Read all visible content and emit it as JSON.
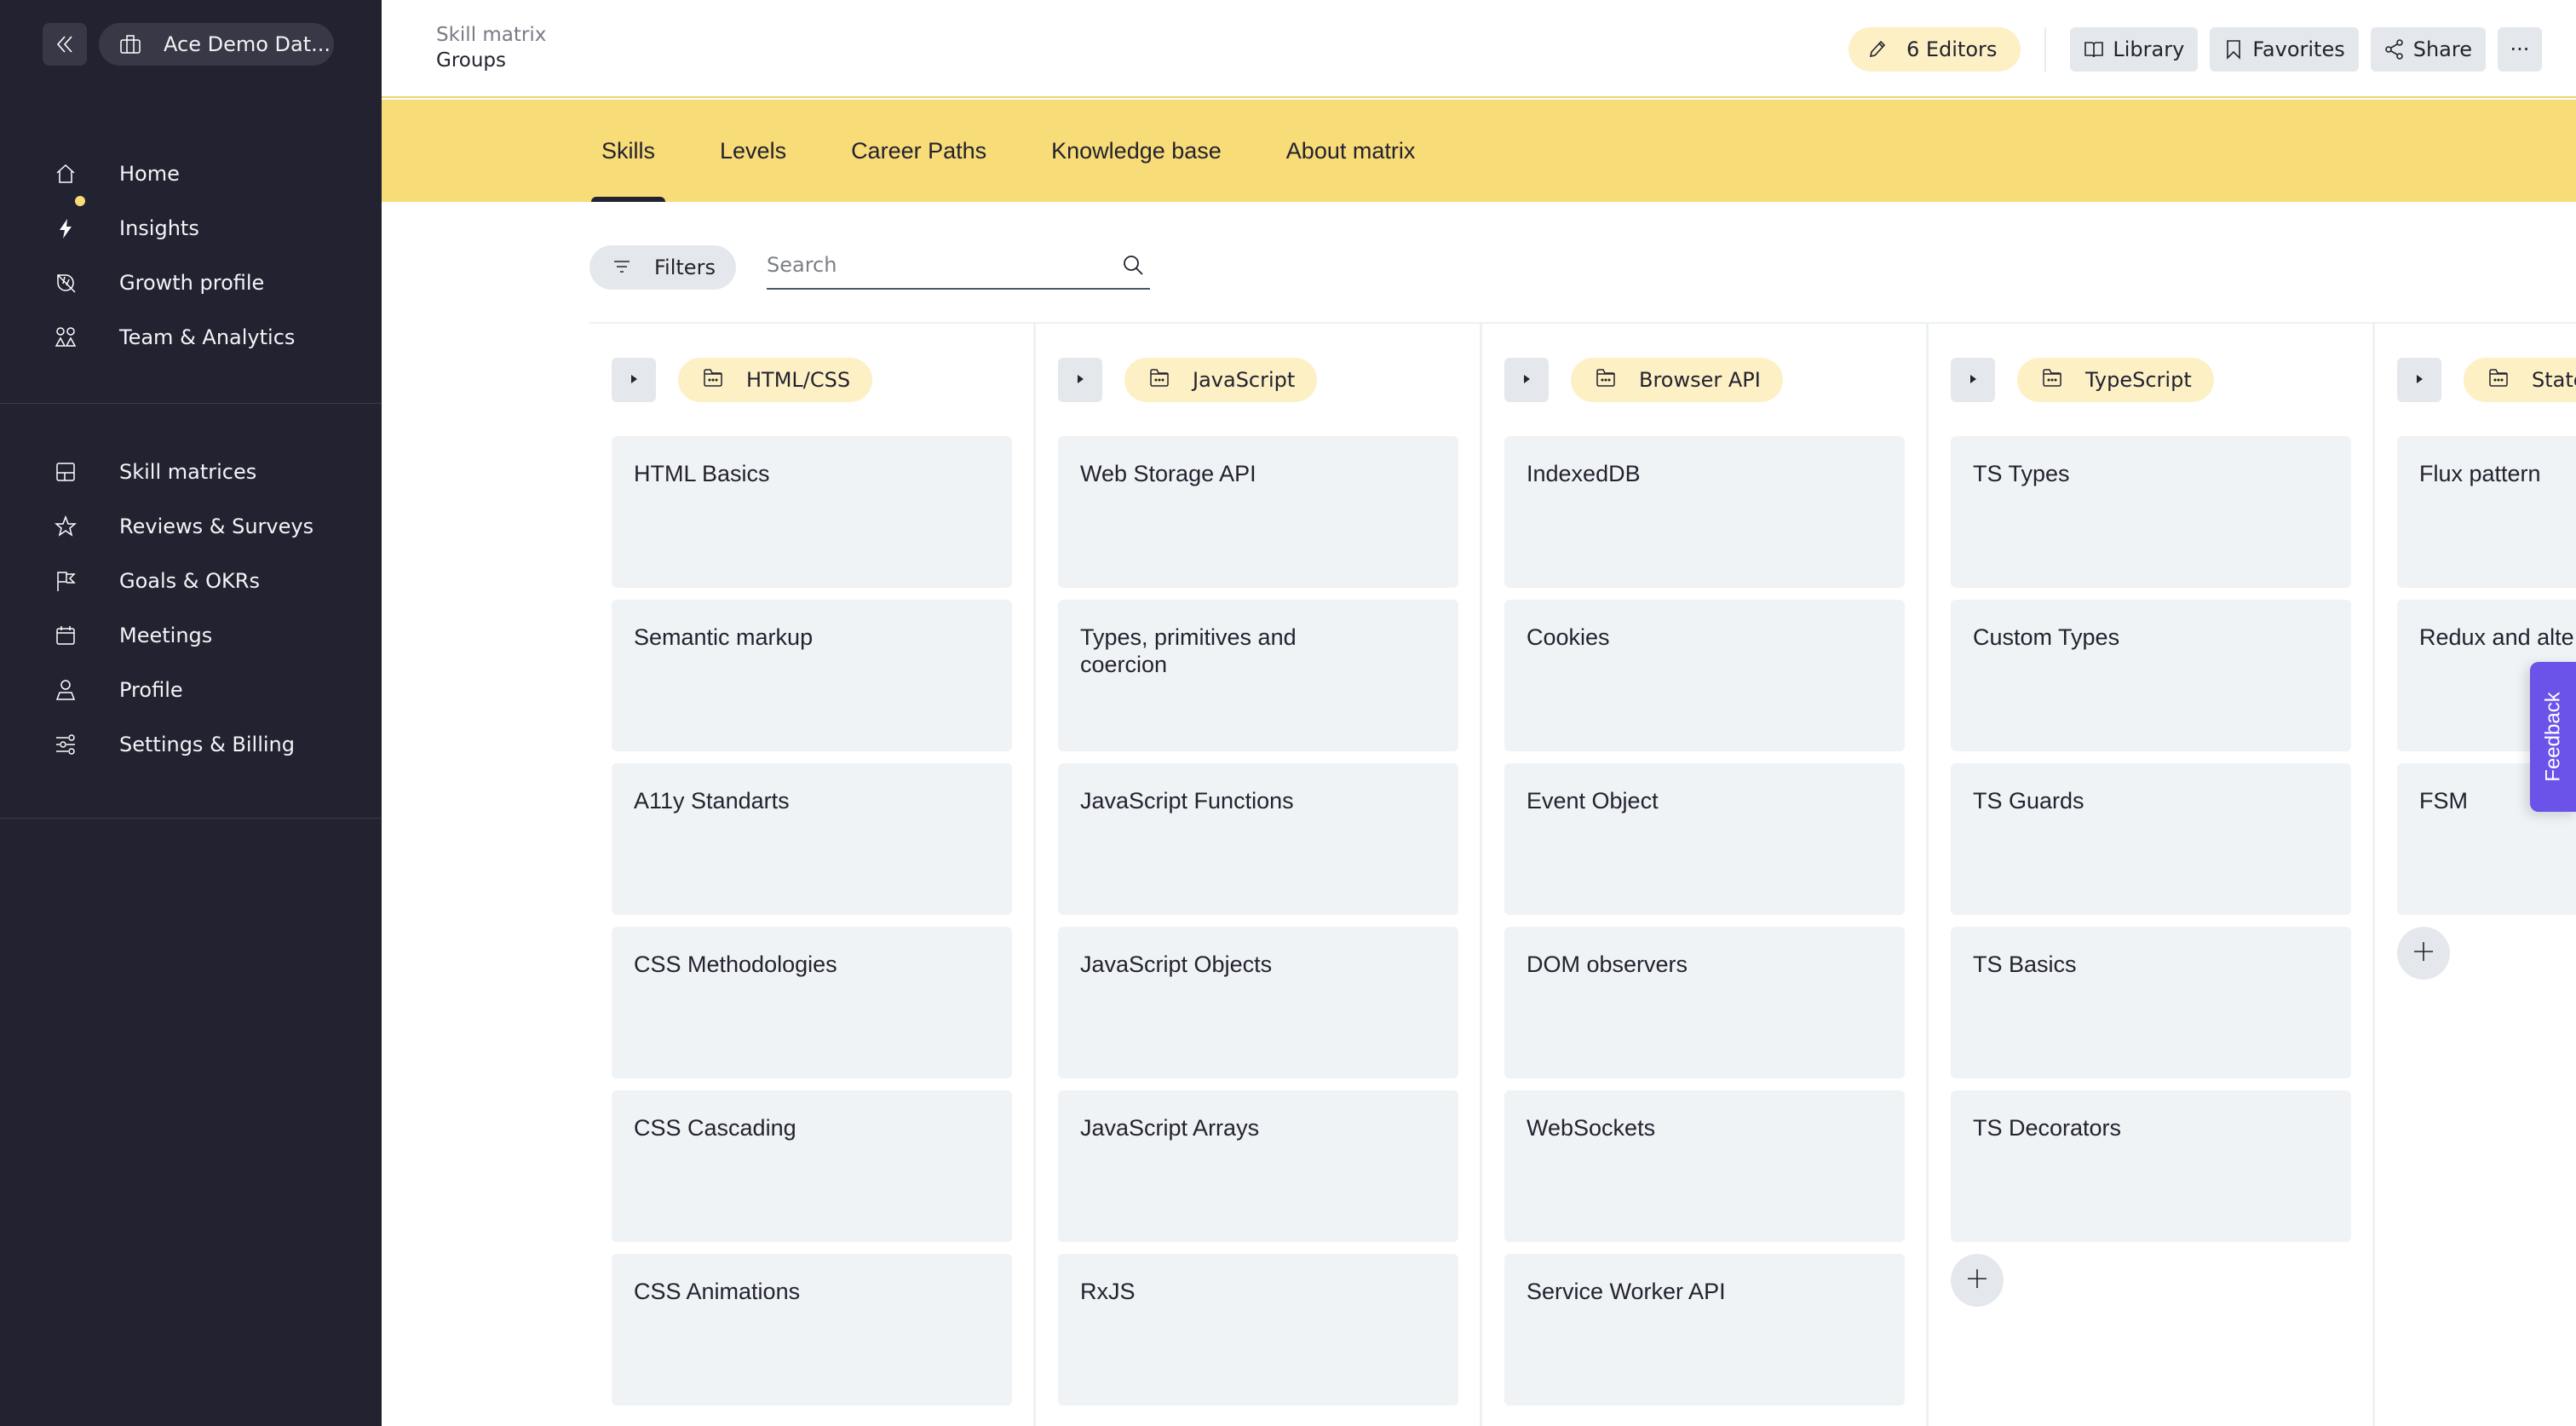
{
  "sidebar": {
    "workspace_name": "Ace Demo Dat...",
    "primary_nav": [
      {
        "label": "Home",
        "icon": "home-icon"
      },
      {
        "label": "Insights",
        "icon": "lightning-icon",
        "notification_dot": true
      },
      {
        "label": "Growth profile",
        "icon": "leaf-icon"
      },
      {
        "label": "Team & Analytics",
        "icon": "team-icon"
      }
    ],
    "secondary_nav": [
      {
        "label": "Skill matrices",
        "icon": "layout-icon"
      },
      {
        "label": "Reviews & Surveys",
        "icon": "star-icon"
      },
      {
        "label": "Goals & OKRs",
        "icon": "flag-icon"
      },
      {
        "label": "Meetings",
        "icon": "calendar-icon"
      },
      {
        "label": "Profile",
        "icon": "user-icon"
      },
      {
        "label": "Settings & Billing",
        "icon": "sliders-icon"
      }
    ]
  },
  "header": {
    "breadcrumb_parent": "Skill matrix",
    "breadcrumb_current": "Groups",
    "editors_label": "6 Editors",
    "library_label": "Library",
    "favorites_label": "Favorites",
    "share_label": "Share",
    "more_label": "···"
  },
  "tabs": [
    {
      "label": "Skills",
      "active": true
    },
    {
      "label": "Levels",
      "active": false
    },
    {
      "label": "Career Paths",
      "active": false
    },
    {
      "label": "Knowledge base",
      "active": false
    },
    {
      "label": "About matrix",
      "active": false
    }
  ],
  "toolbar": {
    "filters_label": "Filters",
    "search_placeholder": "Search",
    "search_value": ""
  },
  "groups": [
    {
      "name": "HTML/CSS",
      "skills": [
        "HTML Basics",
        "Semantic markup",
        "A11y Standarts",
        "CSS Methodologies",
        "CSS Cascading",
        "CSS Animations"
      ]
    },
    {
      "name": "JavaScript",
      "skills": [
        "Web Storage API",
        "Types, primitives and coercion",
        "JavaScript Functions",
        "JavaScript Objects",
        "JavaScript Arrays",
        "RxJS"
      ]
    },
    {
      "name": "Browser API",
      "skills": [
        "IndexedDB",
        "Cookies",
        "Event Object",
        "DOM observers",
        "WebSockets",
        "Service Worker API"
      ]
    },
    {
      "name": "TypeScript",
      "skills": [
        "TS Types",
        "Custom Types",
        "TS Guards",
        "TS Basics",
        "TS Decorators"
      ]
    },
    {
      "name": "State",
      "skills": [
        "Flux pattern",
        "Redux and alte",
        "FSM"
      ]
    }
  ],
  "feedback_label": "Feedback",
  "colors": {
    "sidebar_bg": "#222231",
    "accent_yellow": "#f8dc77",
    "pill_yellow": "#fdf0c4",
    "card_bg": "#eff3f6",
    "feedback_purple": "#6b52e8"
  }
}
